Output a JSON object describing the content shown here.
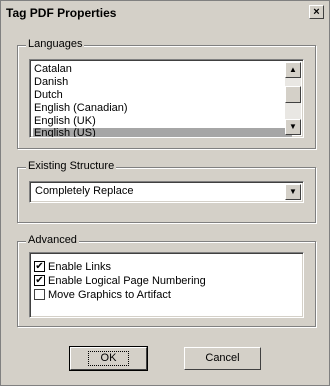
{
  "window": {
    "title": "Tag PDF Properties",
    "close_glyph": "×"
  },
  "languages": {
    "legend": "Languages",
    "items": [
      "Catalan",
      "Danish",
      "Dutch",
      "English (Canadian)",
      "English (UK)",
      "English (US)"
    ],
    "selected": "English (US)"
  },
  "existing_structure": {
    "legend": "Existing Structure",
    "value": "Completely Replace"
  },
  "advanced": {
    "legend": "Advanced",
    "options": [
      {
        "label": "Enable Links",
        "checked": true
      },
      {
        "label": "Enable Logical Page Numbering",
        "checked": true
      },
      {
        "label": "Move Graphics to Artifact",
        "checked": false
      }
    ]
  },
  "buttons": {
    "ok": "OK",
    "cancel": "Cancel"
  },
  "icons": {
    "scroll_up": "▲",
    "scroll_down": "▼",
    "dropdown": "▼",
    "check": "✔"
  }
}
